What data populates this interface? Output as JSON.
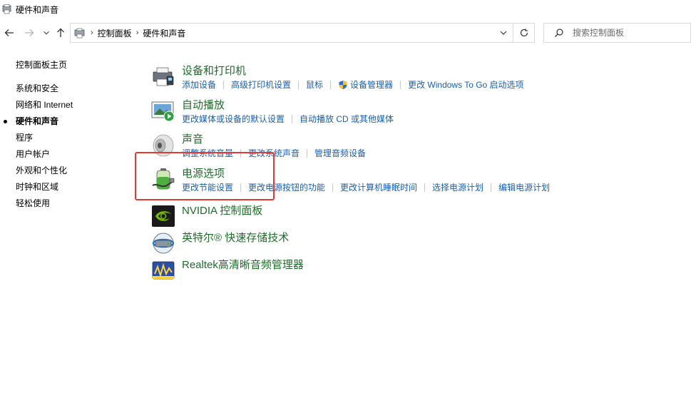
{
  "window": {
    "title": "硬件和声音"
  },
  "nav": {
    "breadcrumb": [
      "控制面板",
      "硬件和声音"
    ],
    "search_placeholder": "搜索控制面板"
  },
  "sidebar": {
    "home": "控制面板主页",
    "items": [
      {
        "label": "系统和安全",
        "active": false
      },
      {
        "label": "网络和 Internet",
        "active": false
      },
      {
        "label": "硬件和声音",
        "active": true
      },
      {
        "label": "程序",
        "active": false
      },
      {
        "label": "用户帐户",
        "active": false
      },
      {
        "label": "外观和个性化",
        "active": false
      },
      {
        "label": "时钟和区域",
        "active": false
      },
      {
        "label": "轻松使用",
        "active": false
      }
    ]
  },
  "categories": [
    {
      "title": "设备和打印机",
      "icon": "printer-icon",
      "links": [
        "添加设备",
        "高级打印机设置",
        "鼠标",
        "设备管理器",
        "更改 Windows To Go 启动选项"
      ]
    },
    {
      "title": "自动播放",
      "icon": "autoplay-icon",
      "links": [
        "更改媒体或设备的默认设置",
        "自动播放 CD 或其他媒体"
      ]
    },
    {
      "title": "声音",
      "icon": "speaker-icon",
      "links": [
        "调整系统音量",
        "更改系统声音",
        "管理音频设备"
      ]
    },
    {
      "title": "电源选项",
      "icon": "battery-icon",
      "links": [
        "更改节能设置",
        "更改电源按钮的功能",
        "更改计算机睡眠时间",
        "选择电源计划",
        "编辑电源计划"
      ]
    },
    {
      "title": "NVIDIA 控制面板",
      "icon": "nvidia-icon",
      "links": []
    },
    {
      "title": "英特尔® 快速存储技术",
      "icon": "intel-storage-icon",
      "links": []
    },
    {
      "title": "Realtek高清晰音频管理器",
      "icon": "realtek-audio-icon",
      "links": []
    }
  ],
  "colors": {
    "title_green": "#1e6e2a",
    "link_blue": "#1a5fb4",
    "highlight_red": "#e53935"
  }
}
